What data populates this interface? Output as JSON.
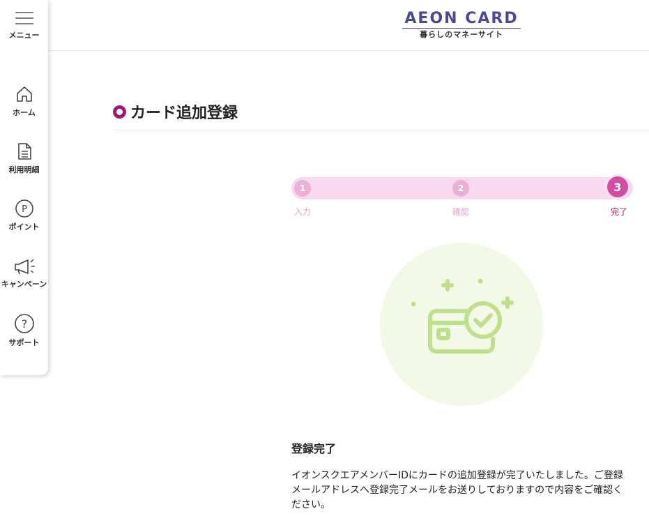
{
  "header": {
    "logo_main": "AEON CARD",
    "logo_sub": "暮らしのマネーサイト",
    "brand_color": "#4b4a93"
  },
  "sidebar": {
    "items": [
      {
        "label": "メニュー",
        "icon": "hamburger-menu-icon"
      },
      {
        "label": "ホーム",
        "icon": "home-icon"
      },
      {
        "label": "利用明細",
        "icon": "document-icon"
      },
      {
        "label": "ポイント",
        "icon": "point-circle-icon"
      },
      {
        "label": "キャンペーン",
        "icon": "megaphone-icon"
      },
      {
        "label": "サポート",
        "icon": "question-circle-icon"
      }
    ]
  },
  "page": {
    "title": "カード追加登録",
    "accent_color": "#9c1a7f"
  },
  "stepper": {
    "steps": [
      {
        "number": "1",
        "label": "入力"
      },
      {
        "number": "2",
        "label": "確認"
      },
      {
        "number": "3",
        "label": "完了"
      }
    ],
    "current_step": 3,
    "track_color": "#f9d9ef",
    "active_color": "#d24ea2"
  },
  "illustration": {
    "icon": "card-check-icon",
    "color": "#bfe08a"
  },
  "completion": {
    "heading": "登録完了",
    "message": "イオンスクエアメンバーIDにカードの追加登録が完了いたしました。ご登録メールアドレスへ登録完了メールをお送りしておりますので内容をご確認ください。"
  }
}
